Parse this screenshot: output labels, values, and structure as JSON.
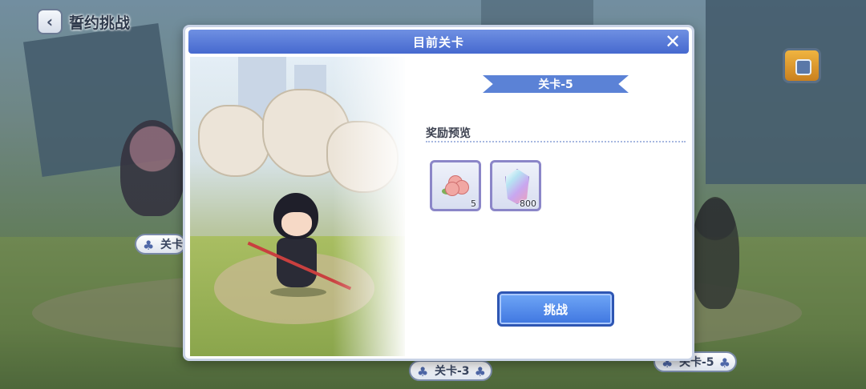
{
  "header": {
    "back_title": "誓约挑战"
  },
  "dialog": {
    "title": "目前关卡",
    "stage_banner": "关卡-5",
    "reward_section_label": "奖励预览",
    "rewards": [
      {
        "icon": "rose-icon",
        "quantity": "5"
      },
      {
        "icon": "crystal-icon",
        "quantity": "800"
      }
    ],
    "challenge_label": "挑战"
  },
  "background": {
    "stage_tags": [
      "关卡",
      "关卡-3",
      "关卡-5"
    ]
  },
  "colors": {
    "header_blue": "#4669cf",
    "button_blue": "#3f76e0",
    "banner_blue": "#5b82d6"
  }
}
